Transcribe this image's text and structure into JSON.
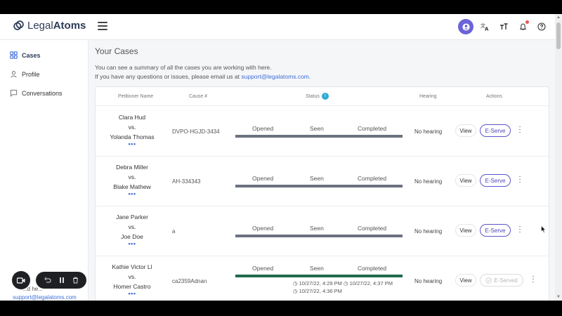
{
  "brand": {
    "name_light": "Legal",
    "name_bold": "Atoms",
    "accent": "#6c63d8"
  },
  "topbar": {
    "icons": [
      "user-icon",
      "translate-icon",
      "text-size-icon",
      "bell-icon",
      "help-icon"
    ]
  },
  "sidebar": {
    "items": [
      {
        "label": "Cases",
        "icon": "grid-icon",
        "active": true
      },
      {
        "label": "Profile",
        "icon": "person-icon",
        "active": false
      },
      {
        "label": "Conversations",
        "icon": "chat-icon",
        "active": false
      }
    ],
    "footer_text": "...d he...",
    "footer_email": "support@legalatoms.com"
  },
  "main": {
    "title": "Your Cases",
    "desc_line1": "You can see a summary of all the cases you are working with here.",
    "desc_line2_prefix": "If you have any questions or issues, please email us at ",
    "desc_email": "support@legalatoms.com",
    "desc_line2_suffix": "."
  },
  "table": {
    "headers": {
      "petitioner": "Petitioner Name",
      "cause": "Cause #",
      "status": "Status",
      "status_info": "i",
      "hearing": "Hearing",
      "actions": "Actions"
    },
    "progress_labels": {
      "opened": "Opened",
      "seen": "Seen",
      "completed": "Completed"
    },
    "view_label": "View",
    "eserve_label": "E-Serve",
    "eserved_label": "E-Served",
    "more_label": "•••",
    "rows": [
      {
        "petitioner": "Clara Hud",
        "vs": "vs.",
        "respondent": "Yolanda Thomas",
        "cause": "DVPO-HGJD-3434",
        "hearing": "No hearing",
        "served": false
      },
      {
        "petitioner": "Debra Miller",
        "vs": "vs.",
        "respondent": "Blake Mathew",
        "cause": "AH-334343",
        "hearing": "No hearing",
        "served": false
      },
      {
        "petitioner": "Jane Parker",
        "vs": "vs.",
        "respondent": "Joe Doe",
        "cause": "a",
        "hearing": "No hearing",
        "served": false
      },
      {
        "petitioner": "Kathie Victor Ll",
        "vs": "vs.",
        "respondent": "Homer Castro",
        "cause": "ca2359Adnan",
        "hearing": "No hearing",
        "served": true,
        "timestamps": {
          "opened": "10/27/22, 4:29 PM",
          "seen": "10/27/22, 4:37 PM",
          "completed": "10/27/22, 4:36 PM"
        }
      }
    ]
  },
  "recorder": {
    "icons": [
      "camera-icon",
      "undo-icon",
      "pause-icon",
      "trash-icon"
    ]
  }
}
